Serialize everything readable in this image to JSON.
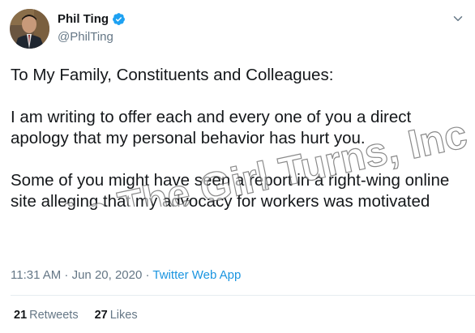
{
  "tweet": {
    "author": {
      "name": "Phil Ting",
      "handle": "@PhilTing",
      "verified": true
    },
    "paragraphs": [
      "To My Family, Constituents and Colleagues:",
      "I am writing to offer each and every one of you a direct apology that my personal behavior has hurt you.",
      "Some of you might have seen a report in a right-wing online site alleging that my advocacy for workers was motivated"
    ],
    "timestamp": "11:31 AM · Jun 20, 2020 · ",
    "source": "Twitter Web App",
    "retweets_count": "21",
    "retweets_label": "Retweets",
    "likes_count": "27",
    "likes_label": "Likes"
  },
  "watermark": "As The Girl Turns, Inc",
  "colors": {
    "text": "#14171a",
    "secondary": "#657786",
    "link": "#1b95e0",
    "verified": "#1da1f2",
    "divider": "#e6ecf0"
  },
  "icons": {
    "verified": "verified-badge-icon",
    "caret": "chevron-down-icon"
  }
}
